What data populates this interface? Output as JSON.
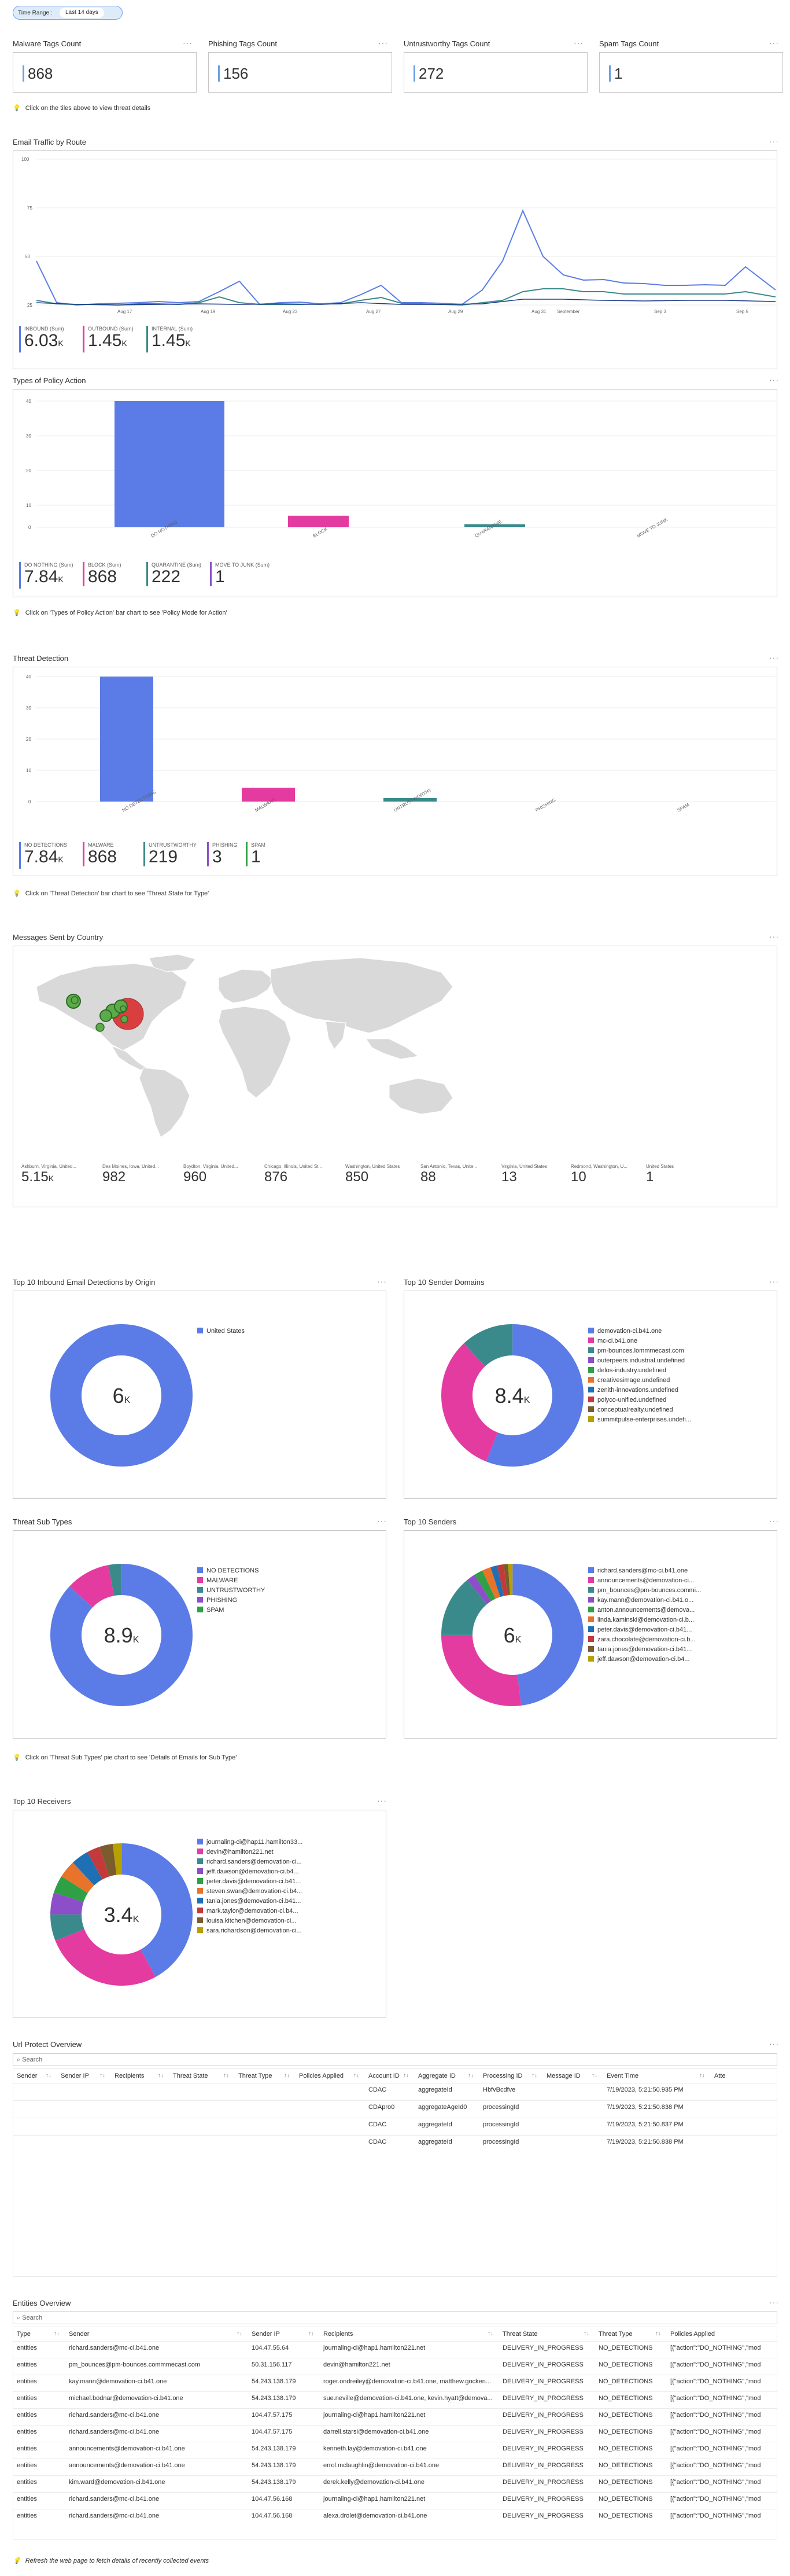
{
  "time_range": {
    "label": "Time Range :",
    "value": "Last 14 days"
  },
  "tiles": [
    {
      "title": "Malware Tags Count",
      "value": "868"
    },
    {
      "title": "Phishing Tags Count",
      "value": "156"
    },
    {
      "title": "Untrustworthy Tags Count",
      "value": "272"
    },
    {
      "title": "Spam Tags Count",
      "value": "1"
    }
  ],
  "menu_dots": "···",
  "info_icon": "💡",
  "notes": {
    "tiles": "Click on the tiles above to view threat details",
    "policy": "Click on 'Types of Policy Action' bar chart to see 'Policy Mode for Action'",
    "threat": "Click on 'Threat Detection' bar chart to see 'Threat State for Type'",
    "subtypes": "Click on 'Threat Sub Types' pie chart to see 'Details of Emails for Sub Type'",
    "refresh": "Refresh the web page to fetch details of recently collected events"
  },
  "traffic": {
    "title": "Email Traffic by Route",
    "legend": [
      {
        "label": "INBOUND (Sum)",
        "value": "6.03",
        "unit": "K",
        "color": "#5b7ce6"
      },
      {
        "label": "OUTBOUND (Sum)",
        "value": "1.45",
        "unit": "K",
        "color": "#e43ba0"
      },
      {
        "label": "INTERNAL (Sum)",
        "value": "1.45",
        "unit": "K",
        "color": "#3a8a8c"
      }
    ]
  },
  "policy": {
    "title": "Types of Policy Action",
    "legend": [
      {
        "label": "DO NOTHING (Sum)",
        "value": "7.84",
        "unit": "K",
        "color": "#5b7ce6"
      },
      {
        "label": "BLOCK (Sum)",
        "value": "868",
        "unit": "",
        "color": "#e43ba0"
      },
      {
        "label": "QUARANTINE (Sum)",
        "value": "222",
        "unit": "",
        "color": "#3a8a8c"
      },
      {
        "label": "MOVE TO JUNK (Sum)",
        "value": "1",
        "unit": "",
        "color": "#8c4fc9"
      }
    ]
  },
  "threat": {
    "title": "Threat Detection",
    "legend": [
      {
        "label": "NO DETECTIONS",
        "value": "7.84",
        "unit": "K",
        "color": "#5b7ce6"
      },
      {
        "label": "MALWARE",
        "value": "868",
        "unit": "",
        "color": "#e43ba0"
      },
      {
        "label": "UNTRUSTWORTHY",
        "value": "219",
        "unit": "",
        "color": "#3a8a8c"
      },
      {
        "label": "PHISHING",
        "value": "3",
        "unit": "",
        "color": "#8c4fc9"
      },
      {
        "label": "SPAM",
        "value": "1",
        "unit": "",
        "color": "#2fa045"
      }
    ]
  },
  "map": {
    "title": "Messages Sent by Country",
    "stats": [
      {
        "label": "Ashburn, Virginia, United...",
        "value": "5.15",
        "unit": "K"
      },
      {
        "label": "Des Moines, Iowa, United...",
        "value": "982",
        "unit": ""
      },
      {
        "label": "Boydton, Virginia, United...",
        "value": "960",
        "unit": ""
      },
      {
        "label": "Chicago, Illinois, United St...",
        "value": "876",
        "unit": ""
      },
      {
        "label": "Washington, United States",
        "value": "850",
        "unit": ""
      },
      {
        "label": "San Antonio, Texas, Unite...",
        "value": "88",
        "unit": ""
      },
      {
        "label": "Virginia, United States",
        "value": "13",
        "unit": ""
      },
      {
        "label": "Redmond, Washington, U...",
        "value": "10",
        "unit": ""
      },
      {
        "label": "United States",
        "value": "1",
        "unit": ""
      }
    ]
  },
  "origin": {
    "title": "Top 10 Inbound Email Detections by Origin",
    "center": "6",
    "unit": "K",
    "legend": [
      {
        "label": "United States",
        "color": "#5b7ce6"
      }
    ]
  },
  "domains": {
    "title": "Top 10 Sender Domains",
    "center": "8.4",
    "unit": "K",
    "legend": [
      {
        "label": "demovation-ci.b41.one",
        "color": "#5b7ce6"
      },
      {
        "label": "mc-ci.b41.one",
        "color": "#e43ba0"
      },
      {
        "label": "pm-bounces.lommmecast.com",
        "color": "#3a8a8c"
      },
      {
        "label": "outerpeers.industrial.undefined",
        "color": "#8c4fc9"
      },
      {
        "label": "delos-industry.undefined",
        "color": "#2fa045"
      },
      {
        "label": "creativesimage.undefined",
        "color": "#e8732a"
      },
      {
        "label": "zenith-innovations.undefined",
        "color": "#1f6fb5"
      },
      {
        "label": "polyco-unified.undefined",
        "color": "#c23a3a"
      },
      {
        "label": "conceptualrealty.undefined",
        "color": "#7a5c2e"
      },
      {
        "label": "summitpulse-enterprises.undefi...",
        "color": "#b8a000"
      }
    ]
  },
  "subtypes": {
    "title": "Threat Sub Types",
    "center": "8.9",
    "unit": "K",
    "legend": [
      {
        "label": "NO DETECTIONS",
        "color": "#5b7ce6"
      },
      {
        "label": "MALWARE",
        "color": "#e43ba0"
      },
      {
        "label": "UNTRUSTWORTHY",
        "color": "#3a8a8c"
      },
      {
        "label": "PHISHING",
        "color": "#8c4fc9"
      },
      {
        "label": "SPAM",
        "color": "#2fa045"
      }
    ]
  },
  "senders": {
    "title": "Top 10 Senders",
    "center": "6",
    "unit": "K",
    "legend": [
      {
        "label": "richard.sanders@mc-ci.b41.one",
        "color": "#5b7ce6"
      },
      {
        "label": "announcements@demovation-ci...",
        "color": "#e43ba0"
      },
      {
        "label": "pm_bounces@pm-bounces.commi...",
        "color": "#3a8a8c"
      },
      {
        "label": "kay.mann@demovation-ci.b41.o...",
        "color": "#8c4fc9"
      },
      {
        "label": "anton.announcements@demova...",
        "color": "#2fa045"
      },
      {
        "label": "linda.kaminski@demovation-ci.b...",
        "color": "#e8732a"
      },
      {
        "label": "peter.davis@demovation-ci.b41...",
        "color": "#1f6fb5"
      },
      {
        "label": "zara.chocolate@demovation-ci.b...",
        "color": "#c23a3a"
      },
      {
        "label": "tania.jones@demovation-ci.b41...",
        "color": "#7a5c2e"
      },
      {
        "label": "jeff.dawson@demovation-ci.b4...",
        "color": "#b8a000"
      }
    ]
  },
  "receivers": {
    "title": "Top 10 Receivers",
    "center": "3.4",
    "unit": "K",
    "legend": [
      {
        "label": "journaling-ci@hap11.hamilton33...",
        "color": "#5b7ce6"
      },
      {
        "label": "devin@hamilton221.net",
        "color": "#e43ba0"
      },
      {
        "label": "richard.sanders@demovation-ci...",
        "color": "#3a8a8c"
      },
      {
        "label": "jeff.dawson@demovation-ci.b4...",
        "color": "#8c4fc9"
      },
      {
        "label": "peter.davis@demovation-ci.b41...",
        "color": "#2fa045"
      },
      {
        "label": "steven.swan@demovation-ci.b4...",
        "color": "#e8732a"
      },
      {
        "label": "tania.jones@demovation-ci.b41...",
        "color": "#1f6fb5"
      },
      {
        "label": "mark.taylor@demovation-ci.b4...",
        "color": "#c23a3a"
      },
      {
        "label": "louisa.kitchen@demovation-ci...",
        "color": "#7a5c2e"
      },
      {
        "label": "sara.richardson@demovation-ci...",
        "color": "#b8a000"
      }
    ]
  },
  "url_protect": {
    "title": "Url Protect Overview",
    "search_placeholder": "Search",
    "columns": [
      "Sender",
      "Sender IP",
      "Recipients",
      "Threat State",
      "Threat Type",
      "Policies Applied",
      "Account ID",
      "Aggregate ID",
      "Processing ID",
      "Message ID",
      "Event Time",
      "Atte"
    ],
    "rows": [
      [
        "",
        "",
        "",
        "",
        "",
        "",
        "CDAC",
        "aggregateId",
        "HbfvBcdfve",
        "",
        "7/19/2023, 5:21:50.935 PM",
        ""
      ],
      [
        "",
        "",
        "",
        "",
        "",
        "",
        "CDApro0",
        "aggregateAgeId0",
        "processingId",
        "",
        "7/19/2023, 5:21:50.838 PM",
        ""
      ],
      [
        "",
        "",
        "",
        "",
        "",
        "",
        "CDAC",
        "aggregateId",
        "processingId",
        "",
        "7/19/2023, 5:21:50.837 PM",
        ""
      ],
      [
        "",
        "",
        "",
        "",
        "",
        "",
        "CDAC",
        "aggregateId",
        "processingId",
        "",
        "7/19/2023, 5:21:50.838 PM",
        ""
      ]
    ]
  },
  "entities": {
    "title": "Entities Overview",
    "search_placeholder": "Search",
    "columns": [
      "Type",
      "Sender",
      "Sender IP",
      "Recipients",
      "Threat State",
      "Threat Type",
      "Policies Applied"
    ],
    "rows": [
      [
        "entities",
        "richard.sanders@mc-ci.b41.one",
        "104.47.55.64",
        "journaling-ci@hap1.hamilton221.net",
        "DELIVERY_IN_PROGRESS",
        "NO_DETECTIONS",
        "[{\"action\":\"DO_NOTHING\",\"mod"
      ],
      [
        "entities",
        "pm_bounces@pm-bounces.commmecast.com",
        "50.31.156.117",
        "devin@hamilton221.net",
        "DELIVERY_IN_PROGRESS",
        "NO_DETECTIONS",
        "[{\"action\":\"DO_NOTHING\",\"mod"
      ],
      [
        "entities",
        "kay.mann@demovation-ci.b41.one",
        "54.243.138.179",
        "roger.ondreiley@demovation-ci.b41.one, matthew.gocken...",
        "DELIVERY_IN_PROGRESS",
        "NO_DETECTIONS",
        "[{\"action\":\"DO_NOTHING\",\"mod"
      ],
      [
        "entities",
        "michael.bodnar@demovation-ci.b41.one",
        "54.243.138.179",
        "sue.neville@demovation-ci.b41.one, kevin.hyatt@demova...",
        "DELIVERY_IN_PROGRESS",
        "NO_DETECTIONS",
        "[{\"action\":\"DO_NOTHING\",\"mod"
      ],
      [
        "entities",
        "richard.sanders@mc-ci.b41.one",
        "104.47.57.175",
        "journaling-ci@hap1.hamilton221.net",
        "DELIVERY_IN_PROGRESS",
        "NO_DETECTIONS",
        "[{\"action\":\"DO_NOTHING\",\"mod"
      ],
      [
        "entities",
        "richard.sanders@mc-ci.b41.one",
        "104.47.57.175",
        "darrell.starsi@demovation-ci.b41.one",
        "DELIVERY_IN_PROGRESS",
        "NO_DETECTIONS",
        "[{\"action\":\"DO_NOTHING\",\"mod"
      ],
      [
        "entities",
        "announcements@demovation-ci.b41.one",
        "54.243.138.179",
        "kenneth.lay@demovation-ci.b41.one",
        "DELIVERY_IN_PROGRESS",
        "NO_DETECTIONS",
        "[{\"action\":\"DO_NOTHING\",\"mod"
      ],
      [
        "entities",
        "announcements@demovation-ci.b41.one",
        "54.243.138.179",
        "errol.mclaughlin@demovation-ci.b41.one",
        "DELIVERY_IN_PROGRESS",
        "NO_DETECTIONS",
        "[{\"action\":\"DO_NOTHING\",\"mod"
      ],
      [
        "entities",
        "kim.ward@demovation-ci.b41.one",
        "54.243.138.179",
        "derek.kelly@demovation-ci.b41.one",
        "DELIVERY_IN_PROGRESS",
        "NO_DETECTIONS",
        "[{\"action\":\"DO_NOTHING\",\"mod"
      ],
      [
        "entities",
        "richard.sanders@mc-ci.b41.one",
        "104.47.56.168",
        "journaling-ci@hap1.hamilton221.net",
        "DELIVERY_IN_PROGRESS",
        "NO_DETECTIONS",
        "[{\"action\":\"DO_NOTHING\",\"mod"
      ],
      [
        "entities",
        "richard.sanders@mc-ci.b41.one",
        "104.47.56.168",
        "alexa.drolet@demovation-ci.b41.one",
        "DELIVERY_IN_PROGRESS",
        "NO_DETECTIONS",
        "[{\"action\":\"DO_NOTHING\",\"mod"
      ]
    ]
  }
}
